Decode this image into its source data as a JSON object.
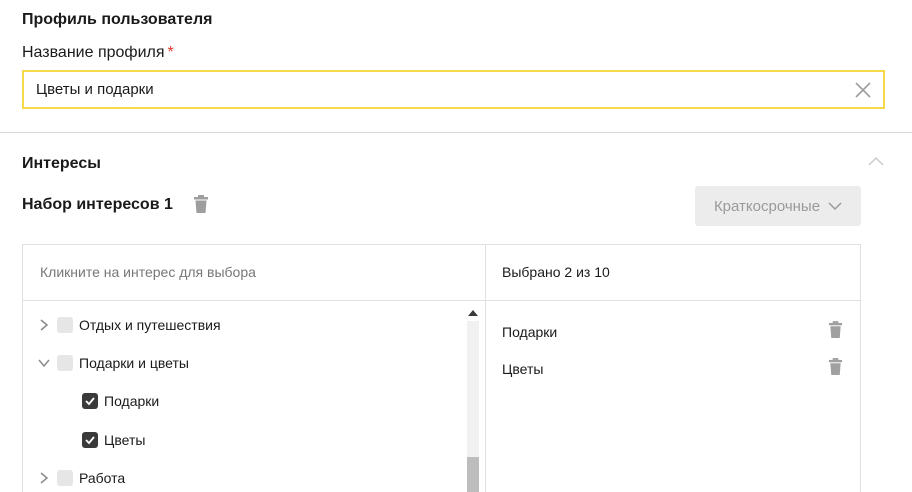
{
  "profile": {
    "section_title": "Профиль пользователя",
    "name_label": "Название профиля",
    "required_mark": "*",
    "name_value": "Цветы и подарки"
  },
  "interests": {
    "section_title": "Интересы",
    "set_title": "Набор интересов 1",
    "term_select": "Краткосрочные",
    "left_hint": "Кликните на интерес для выбора",
    "selected_counter": "Выбрано 2 из 10",
    "tree": [
      {
        "label": "Отдых и путешествия",
        "state": "unchecked",
        "expanded": false
      },
      {
        "label": "Подарки и цветы",
        "state": "unchecked",
        "expanded": true
      },
      {
        "label": "Подарки",
        "state": "checked"
      },
      {
        "label": "Цветы",
        "state": "checked"
      },
      {
        "label": "Работа",
        "state": "unchecked",
        "expanded": false
      }
    ],
    "selected": [
      {
        "label": "Подарки"
      },
      {
        "label": "Цветы"
      }
    ]
  },
  "colors": {
    "input_focus_border": "#f5d94a",
    "required_star": "#e3342f",
    "checkbox_checked": "#3a3a3a",
    "checkbox_empty": "#e6e6e6",
    "icon_gray": "#9e9e9e",
    "dropdown_bg": "#ececec"
  },
  "icons": {
    "clear": "close-icon",
    "collapse": "chevron-up-icon",
    "delete": "trash-icon",
    "dropdown": "chevron-down-icon",
    "expand": "chevron-right-icon",
    "expanded": "chevron-down-icon",
    "check": "check-icon"
  }
}
